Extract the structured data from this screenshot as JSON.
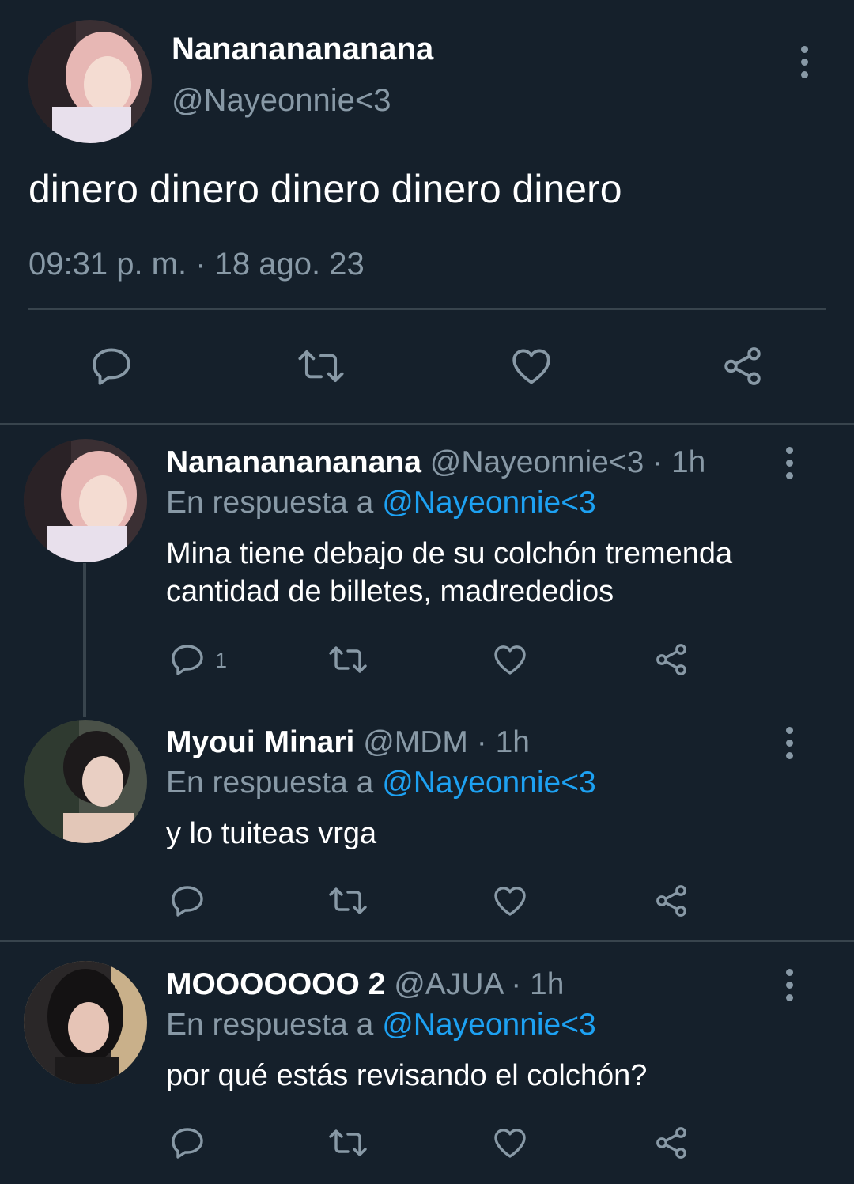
{
  "main_tweet": {
    "display_name": "Nanananananana",
    "handle": "@Nayeonnie<3",
    "text": "dinero dinero dinero dinero dinero",
    "timestamp": "09:31 p. m. · 18 ago. 23",
    "actions": [
      "reply-icon",
      "retweet-icon",
      "like-icon",
      "share-icon"
    ]
  },
  "replies": [
    {
      "display_name": "Nanananananana",
      "handle": "@Nayeonnie<3",
      "time": "· 1h",
      "reply_prefix": "En respuesta a",
      "reply_to": "@Nayeonnie<3",
      "text": "Mina tiene debajo de su colchón tremenda cantidad de billetes, madrededios",
      "reply_count": "1"
    },
    {
      "display_name": "Myoui Minari",
      "handle": "@MDM",
      "time": "· 1h",
      "reply_prefix": "En respuesta a",
      "reply_to": "@Nayeonnie<3",
      "text": "y lo tuiteas vrga",
      "reply_count": ""
    },
    {
      "display_name": "MOOOOOOO 2",
      "handle": "@AJUA",
      "time": "· 1h",
      "reply_prefix": "En respuesta a",
      "reply_to": "@Nayeonnie<3",
      "text": "por qué estás revisando el colchón?",
      "reply_count": ""
    }
  ],
  "colors": {
    "background": "#15202b",
    "muted": "#8899a6",
    "link": "#1da1f2",
    "divider": "#38444d"
  }
}
